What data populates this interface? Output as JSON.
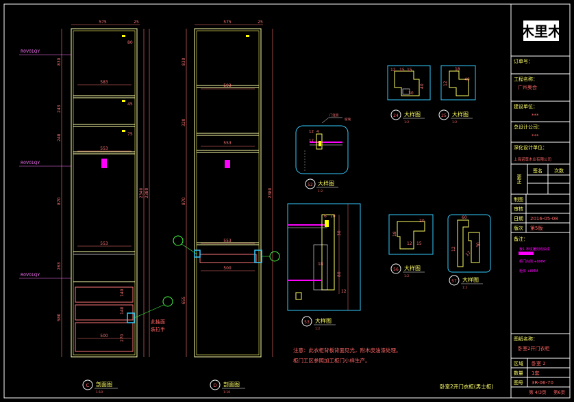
{
  "dims": {
    "top_width": "575",
    "top_gap": "25",
    "sec1_shelf_1": "583",
    "sec1_shelf_2": "553",
    "sec1_shelf_3": "553",
    "sec1_d1": "80",
    "sec1_d2": "45",
    "sec1_d3": "75",
    "sec1_drawer_w": "500",
    "sec2_shelf_1": "593",
    "sec2_shelf_2": "553",
    "sec2_shelf_3": "553",
    "sec2_drawer_w": "500",
    "sec2_left_1": "830",
    "sec2_left_2": "320",
    "sec2_left_3": "870",
    "sec2_left_4": "655",
    "overall_h": "2380",
    "sec1_left_1": "830",
    "sec1_left_2": "243",
    "sec1_left_3": "248",
    "sec1_left_4": "870",
    "sec1_left_5": "263",
    "sec1_left_6": "580",
    "sec1_right_a": "2340",
    "sec1_right_b": "2380",
    "sec1_drawer_1": "140",
    "sec1_drawer_2": "140",
    "sec1_drawer_3": "270"
  },
  "tags": {
    "left_1": "R0V01QY",
    "left_2": "R0V01QY",
    "left_3": "R0V01QY"
  },
  "callouts": {
    "handle_note_1": "此抽面",
    "handle_note_2": "装拉手"
  },
  "details": {
    "d24_dims": [
      "12",
      "15",
      "15",
      "40",
      "30"
    ],
    "d25_dims": [
      "18",
      "12",
      "40"
    ],
    "d56_dims": [
      "18",
      "20",
      "15",
      "12"
    ],
    "d57_dims": [
      "60",
      "12",
      "17",
      "30"
    ],
    "d52_dims": [
      "12",
      "4",
      "12"
    ],
    "d52_label_top": "门连装",
    "d52_label_top2": "玻璃",
    "d53_dims": [
      "6",
      "10",
      "30",
      "18",
      "80",
      "12"
    ]
  },
  "labels": {
    "section_c": {
      "code": "C",
      "name": "剖面图",
      "scale": "1:10"
    },
    "section_d": {
      "code": "D",
      "name": "剖面图",
      "scale": "1:10"
    },
    "d52": {
      "code": "52",
      "name": "大样图",
      "scale": "1:2"
    },
    "d53": {
      "code": "53",
      "name": "大样图",
      "scale": "1:2"
    },
    "d24": {
      "code": "24",
      "name": "大样图",
      "scale": "1:2"
    },
    "d25": {
      "code": "25",
      "name": "大样图",
      "scale": "1:2"
    },
    "d56": {
      "code": "56",
      "name": "大样图",
      "scale": "1:2"
    },
    "d57": {
      "code": "57",
      "name": "大样图",
      "scale": "1:2"
    }
  },
  "notes": {
    "line1": "注意：此衣柜背板背面见光，附木皮油漆处理。",
    "line2": "柜门工区参照加工柜门小样生产。"
  },
  "drawing_title": "卧室2开门衣柜(男士柜)",
  "title_block": {
    "logo": "木里木",
    "order_no_label": "订单号：",
    "project_label": "工程名称：",
    "project_value": "广州奥会",
    "client_label": "建设单位：",
    "client_value": "***",
    "designer_label": "总设计公司：",
    "designer_value": "***",
    "deepening_label": "深化设计单位：",
    "deepening_value": "上海诺尊木业有限公司",
    "signature_label": "签名",
    "date_col": "日期",
    "rev_col": "次数",
    "revision_label": "更正",
    "draw_label": "制图",
    "review_label": "审核",
    "date_label": "日期",
    "date_value": "2016-05-08",
    "version_label": "版次",
    "version_value": "第5版",
    "remarks_label": "备注：",
    "legend_1": "板1  布纹雕刻线油漆",
    "legend_2": "柜门内侧 +8MM",
    "legend_3": "柜体 +8MM",
    "drawing_name_label": "图纸名称：",
    "drawing_name_value": "卧室2开门衣柜",
    "area_label": "区域",
    "area_value": "卧室 2",
    "qty_label": "数量",
    "qty_value": "1套",
    "no_label": "图号",
    "no_value": "3R-06-70",
    "page_value": "第 4/3页",
    "page_value2": "第6页"
  },
  "colors": {
    "frame": "#ffffff",
    "carcass": "#ffffaa",
    "dim": "#ff7777",
    "text_red": "#ff6666",
    "cyan": "#33ccff",
    "magenta": "#ff00ff",
    "green": "#44ff44",
    "text_yellow": "#ffff66"
  }
}
